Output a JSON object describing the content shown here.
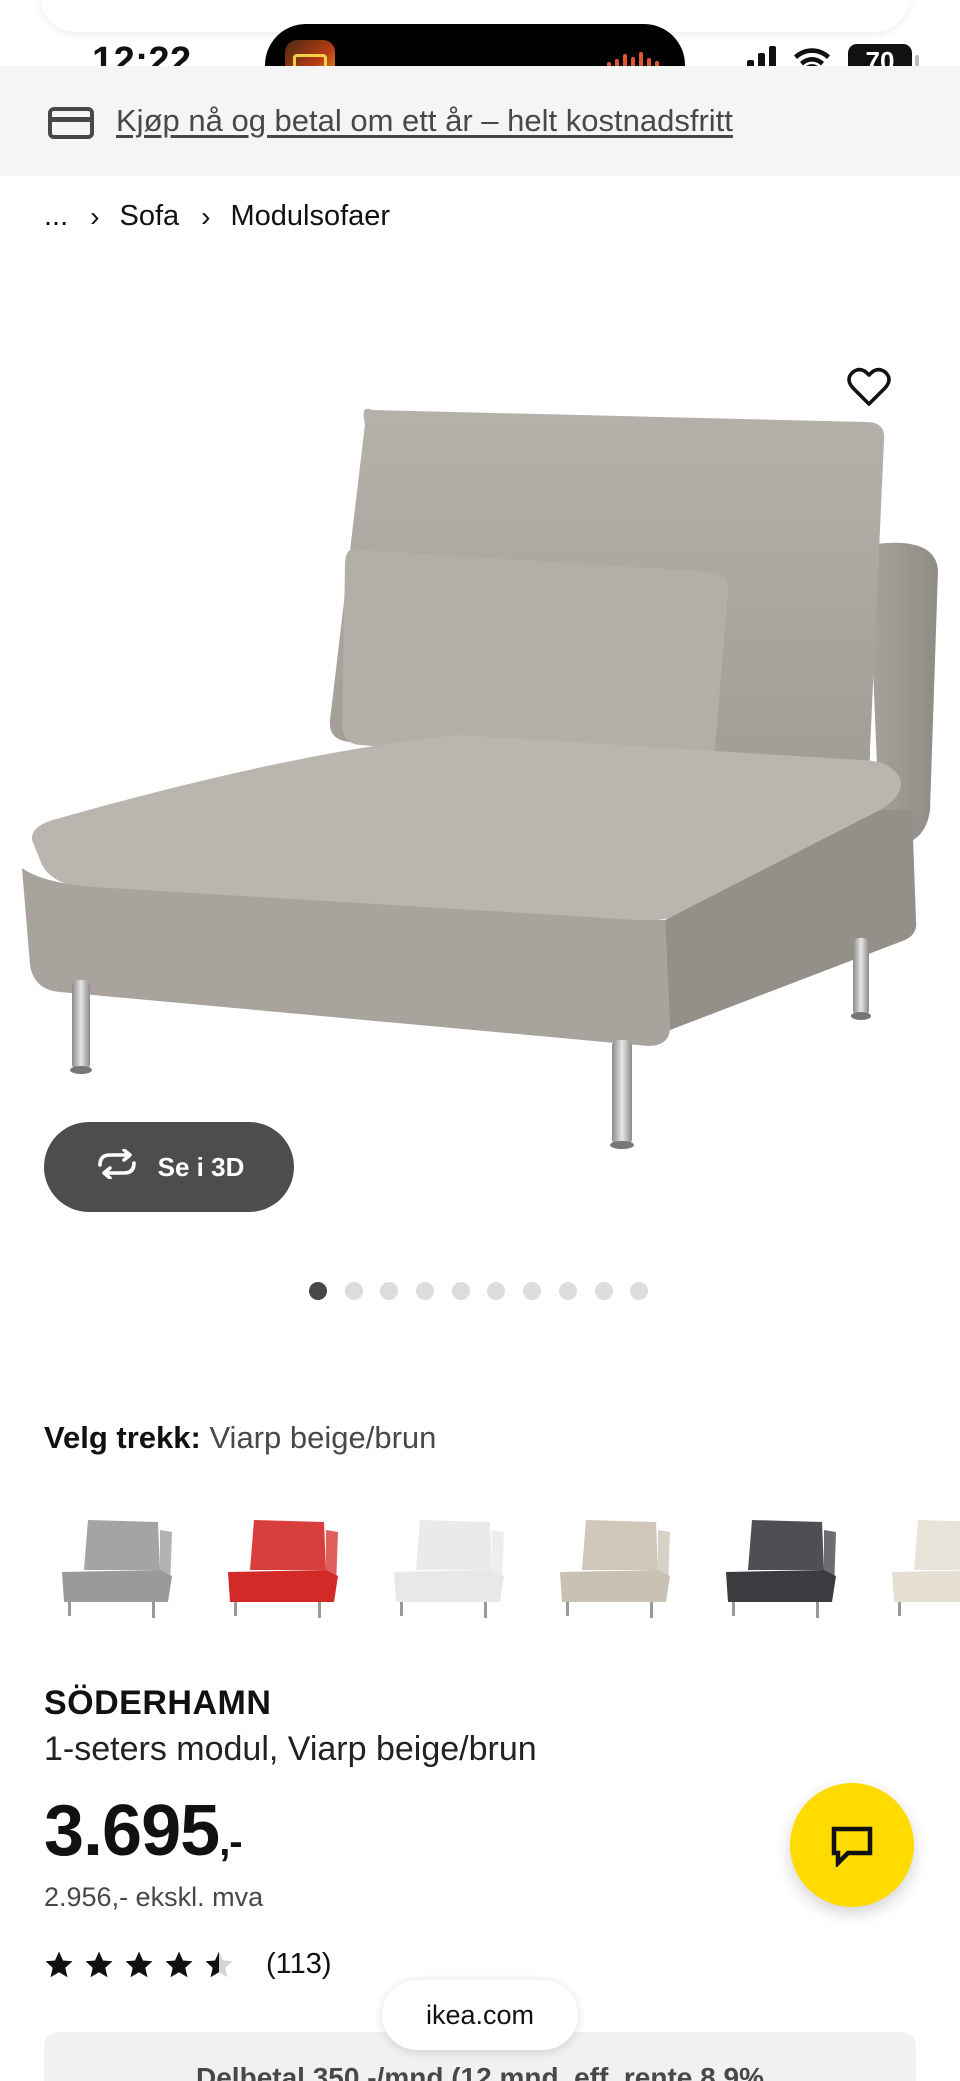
{
  "status_bar": {
    "time": "12:22",
    "battery": "70"
  },
  "promo": {
    "icon": "credit-card-icon",
    "text": "Kjøp nå og betal om ett år – helt kostnadsfritt"
  },
  "breadcrumb": {
    "ellipsis": "...",
    "items": [
      "Sofa",
      "Modulsofaer"
    ]
  },
  "gallery": {
    "view_3d_label": "Se i 3D",
    "image_count": 10,
    "active_index": 0
  },
  "variant": {
    "label": "Velg trekk:",
    "selected": "Viarp beige/brun",
    "colors": [
      "#9a9a9a",
      "#d42a27",
      "#e8e8e6",
      "#c9c1b3",
      "#3b3c3f",
      "#e6e0d4"
    ]
  },
  "product": {
    "name": "SÖDERHAMN",
    "description": "1-seters modul, Viarp beige/brun",
    "price": "3.695",
    "price_suffix": ",-",
    "price_ex_vat": "2.956,- ekskl. mva",
    "rating": 4.5,
    "rating_max": 5,
    "review_count": "(113)"
  },
  "installment": {
    "text": "Delbetal 350,-/mnd (12 mnd, eff. rente 8,9%"
  },
  "browser": {
    "url": "ikea.com"
  },
  "colors": {
    "chat_button": "#ffdb00",
    "button_3d": "#4d4d4d"
  }
}
